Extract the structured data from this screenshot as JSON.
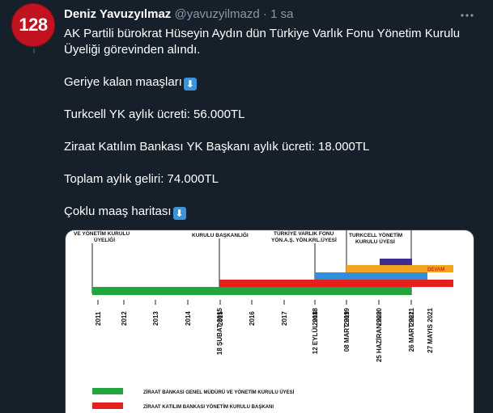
{
  "tweet": {
    "avatar_text": "128",
    "display_name": "Deniz Yavuzyılmaz",
    "handle": "@yavuzyilmazd",
    "separator": "·",
    "time": "1 sa",
    "more_icon": "more-horizontal-icon",
    "lines": [
      "AK Partili bürokrat Hüseyin Aydın dün Türkiye Varlık Fonu Yönetim Kurulu",
      "Üyeliği görevinden alındı.",
      "Geriye kalan maaşları",
      "Turkcell YK aylık ücreti: 56.000TL",
      "Ziraat Katılım Bankası YK Başkanı aylık ücreti: 18.000TL",
      "Toplam aylık geliri: 74.000TL",
      "Çoklu maaş haritası"
    ],
    "emoji_glyph": "⬇",
    "emoji_icon": "down-arrow-emoji-icon"
  },
  "image": {
    "top_labels": [
      "VE YÖNETİM KURULU",
      "ÜYELİĞİ",
      "KURULU BAŞKANLIĞI",
      "TÜRKİYE VARLIK FONU",
      "YÖN.A.Ş. YÖN.KRL.ÜYESİ",
      "TURKCELL YÖNETİM",
      "KURULU ÜYESİ"
    ],
    "devam_label": "DEVAM",
    "years": [
      "2011",
      "2012",
      "2013",
      "2014",
      "2015",
      "2016",
      "2017",
      "2018",
      "2019",
      "2020",
      "2021"
    ],
    "date_labels": [
      "18 ŞUBAT 2015",
      "12 EYLÜL 2018",
      "08 MART 2019",
      "25 HAZİRAN 2020",
      "26 MART 2021",
      "27 MAYIS 2021"
    ],
    "legend": [
      {
        "label": "ZİRAAT BANKASI GENEL MÜDÜRÜ VE YÖNETİM KURULU ÜYESİ",
        "color": "#22a53b"
      },
      {
        "label": "ZİRAAT KATILIM BANKASI YÖNETİM KURULU BAŞKANI",
        "color": "#e3201b"
      }
    ],
    "colors": {
      "green": "#22a53b",
      "red": "#e3201b",
      "blue": "#2f8fd8",
      "orange": "#f2a51c",
      "purple": "#3d2b8f"
    }
  }
}
